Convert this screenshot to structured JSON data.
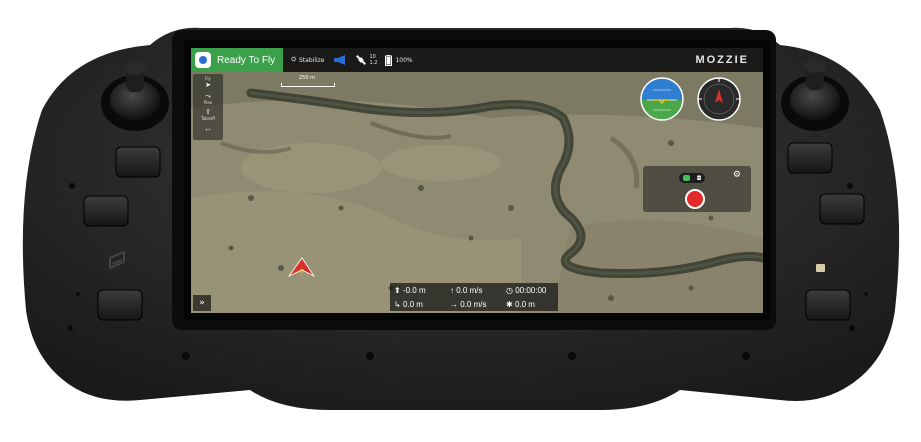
{
  "status": {
    "label": "Ready To Fly",
    "color": "#3aa04a"
  },
  "topbar": {
    "mode": "Stabilize",
    "gps_count": "10",
    "gps_hdop": "1.2",
    "battery": "100%",
    "brand": "MOZZIE"
  },
  "toolstrip": [
    {
      "label": "Fly",
      "icon": "send-icon"
    },
    {
      "label": "Plan",
      "icon": "route-icon"
    },
    {
      "label": "Takeoff",
      "icon": "takeoff-icon"
    },
    {
      "label": "",
      "icon": "return-icon"
    }
  ],
  "map": {
    "scale_label": "250 m"
  },
  "telemetry": {
    "altitude": "-0.0 m",
    "vertical_speed": "0.0 m/s",
    "flight_time": "00:00:00",
    "distance": "0.0 m",
    "horizontal_speed": "0.0 m/s",
    "distance_home": "0.0 m"
  },
  "expand_label": "»",
  "colors": {
    "accent": "#3aa04a",
    "record": "#e32a2a",
    "vehicle": "#d6322a",
    "horizon_sky": "#2f7fd0",
    "horizon_ground": "#4aa84a"
  }
}
